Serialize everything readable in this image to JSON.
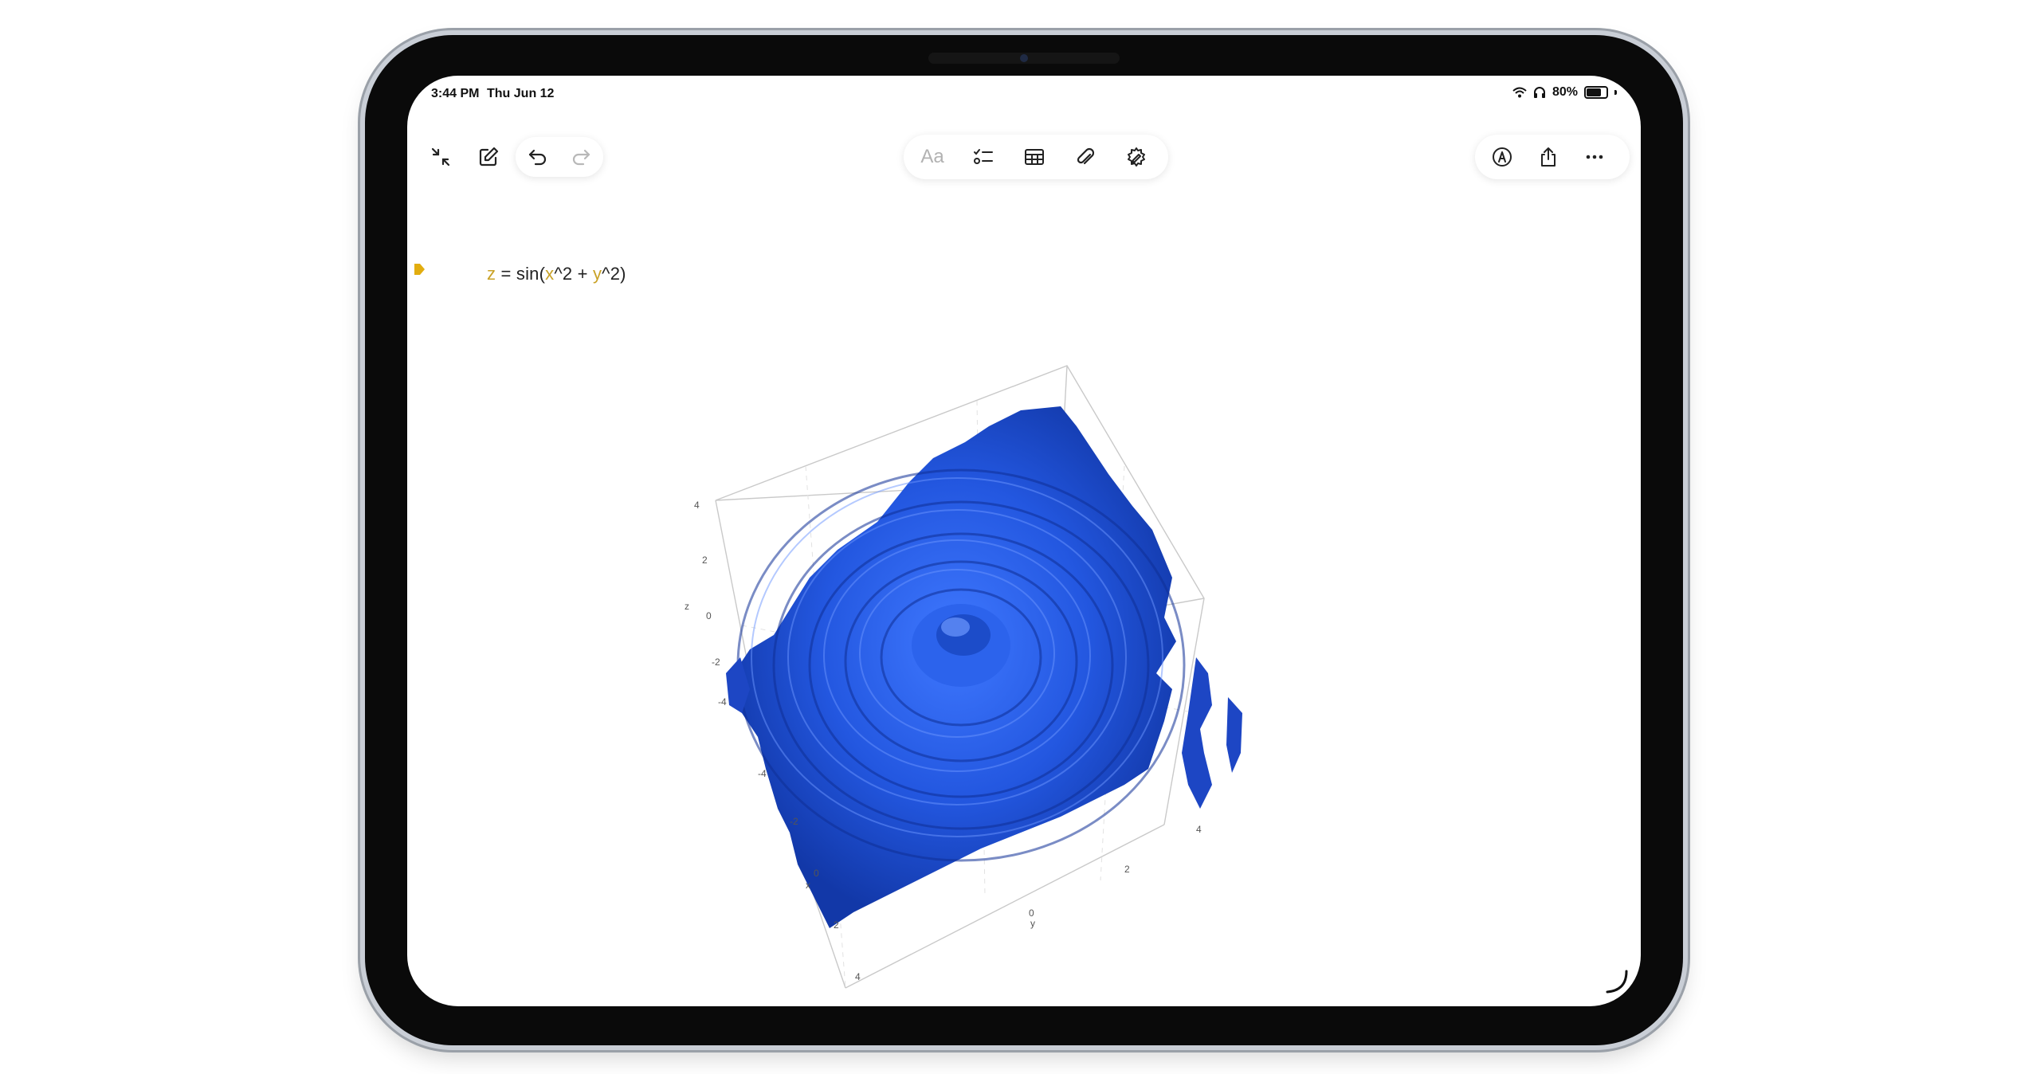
{
  "status": {
    "time": "3:44 PM",
    "date": "Thu Jun 12",
    "battery": "80%",
    "battery_level": 0.8
  },
  "toolbar_left": [
    {
      "icon": "collapse-icon"
    },
    {
      "icon": "compose-icon"
    },
    {
      "icon": "undo-icon"
    },
    {
      "icon": "redo-icon",
      "disabled": true
    }
  ],
  "toolbar_center": {
    "format_label": "Aa",
    "items": [
      "checklist-icon",
      "table-icon",
      "attachment-icon",
      "math-pencil-icon"
    ]
  },
  "toolbar_right": [
    "markup-icon",
    "share-icon",
    "more-icon"
  ],
  "equation": {
    "z": "z",
    "eq": " = sin(",
    "x": "x",
    "mid": "^2 + ",
    "y": "y",
    "end": "^2)"
  },
  "chart_data": {
    "type": "surface",
    "function": "z = sin(x^2 + y^2)",
    "surface_color": "#1f4fd1",
    "z_ticks": [
      "4",
      "2",
      "0",
      "-2",
      "-4"
    ],
    "z_label": "z",
    "x_ticks": [
      "-4",
      "-2",
      "0",
      "2",
      "4"
    ],
    "x_label": "x",
    "y_ticks": [
      "0",
      "2",
      "4"
    ],
    "y_label": "y"
  },
  "colors": {
    "variable": "#c9a227",
    "accent": "#1f4fd1"
  }
}
